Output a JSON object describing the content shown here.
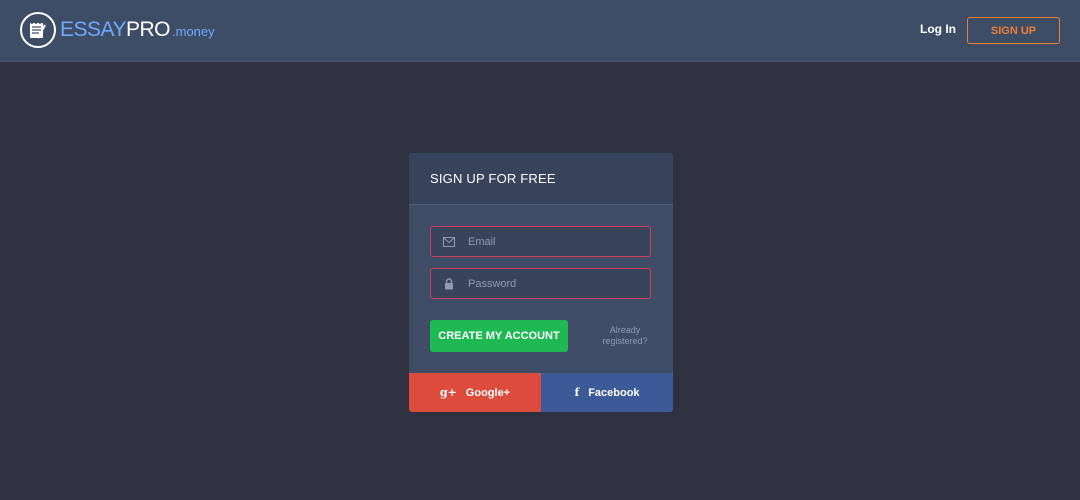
{
  "header": {
    "logo": {
      "brand_part1": "ESSAY",
      "brand_part2": "PRO",
      "brand_suffix": ".money",
      "icon": "notepad-pen-icon"
    },
    "login_label": "Log In",
    "signup_label": "SIGN UP"
  },
  "form": {
    "title": "SIGN UP FOR FREE",
    "email": {
      "placeholder": "Email",
      "value": "",
      "icon": "envelope-icon"
    },
    "password": {
      "placeholder": "Password",
      "value": "",
      "icon": "lock-icon"
    },
    "submit_label": "CREATE MY ACCOUNT",
    "already_registered": "Already registered?",
    "social": [
      {
        "label": "Google+",
        "icon": "google-plus-icon",
        "glyph": "g+"
      },
      {
        "label": "Facebook",
        "icon": "facebook-icon",
        "glyph": "f"
      }
    ]
  },
  "colors": {
    "page_bg": "#2d3140",
    "header_bg": "#3e4d66",
    "card_bg": "#3e4c65",
    "accent_orange": "#ef7f36",
    "accent_blue": "#6fa9ff",
    "success_green": "#1fb954",
    "error_red": "#d23c5a",
    "google_red": "#dc4b3b",
    "facebook_blue": "#3c5998"
  }
}
